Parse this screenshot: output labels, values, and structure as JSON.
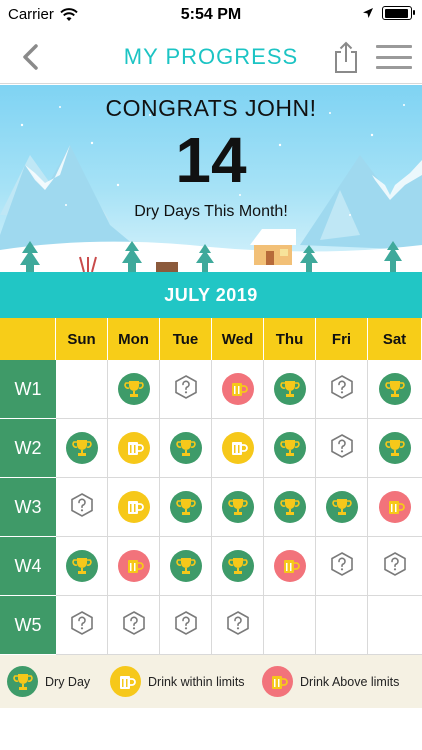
{
  "status_bar": {
    "carrier": "Carrier",
    "time": "5:54 PM"
  },
  "nav": {
    "title": "MY PROGRESS"
  },
  "hero": {
    "congrats": "CONGRATS JOHN!",
    "count": "14",
    "subtitle": "Dry Days This Month!"
  },
  "calendar": {
    "month": "JULY 2019",
    "days": [
      "Sun",
      "Mon",
      "Tue",
      "Wed",
      "Thu",
      "Fri",
      "Sat"
    ],
    "weeks": [
      {
        "label": "W1",
        "cells": [
          "",
          "dry",
          "unknown",
          "above",
          "dry",
          "unknown",
          "dry"
        ]
      },
      {
        "label": "W2",
        "cells": [
          "dry",
          "within",
          "dry",
          "within",
          "dry",
          "unknown",
          "dry"
        ]
      },
      {
        "label": "W3",
        "cells": [
          "unknown",
          "within",
          "dry",
          "dry",
          "dry",
          "dry",
          "above"
        ]
      },
      {
        "label": "W4",
        "cells": [
          "dry",
          "above",
          "dry",
          "dry",
          "above",
          "unknown",
          "unknown"
        ]
      },
      {
        "label": "W5",
        "cells": [
          "unknown",
          "unknown",
          "unknown",
          "unknown",
          "",
          "",
          ""
        ]
      }
    ]
  },
  "legend": {
    "dry": "Dry Day",
    "within": "Drink within limits",
    "above": "Drink Above limits"
  },
  "colors": {
    "accent_teal": "#21c6c5",
    "header_yellow": "#f7cd18",
    "week_green": "#3f9a68",
    "dry_green": "#3e9b69",
    "within_yellow": "#f6c81a",
    "above_red": "#f2737b"
  }
}
